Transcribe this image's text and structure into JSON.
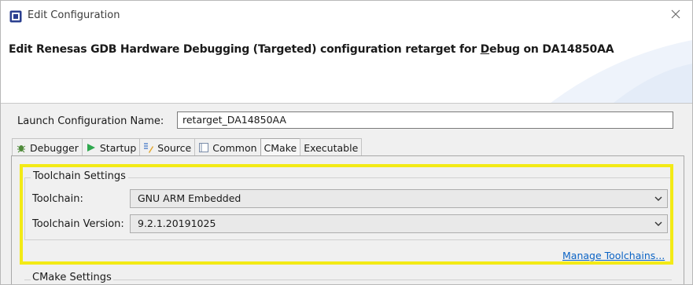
{
  "window": {
    "title": "Edit Configuration"
  },
  "banner": {
    "title_pre": "Edit Renesas GDB Hardware Debugging (Targeted) configuration retarget for ",
    "title_mnemonic": "D",
    "title_post": "ebug on DA14850AA"
  },
  "launch": {
    "label": "Launch Configuration Name:",
    "value": "retarget_DA14850AA"
  },
  "tabs": [
    {
      "label": "Debugger",
      "icon": "bug-icon"
    },
    {
      "label": "Startup",
      "icon": "play-icon"
    },
    {
      "label": "Source",
      "icon": "source-icon"
    },
    {
      "label": "Common",
      "icon": "common-icon"
    },
    {
      "label": "CMake",
      "icon": "none"
    },
    {
      "label": "Executable",
      "icon": "none"
    }
  ],
  "active_tab": "CMake",
  "toolchain_settings": {
    "group_title": "Toolchain Settings",
    "toolchain_label": "Toolchain:",
    "toolchain_value": "GNU ARM Embedded",
    "version_label": "Toolchain Version:",
    "version_value": "9.2.1.20191025",
    "manage_link": "Manage Toolchains..."
  },
  "cmake_settings": {
    "group_title": "CMake Settings"
  },
  "colors": {
    "highlight": "#f3ea16",
    "link": "#0b63c5"
  }
}
